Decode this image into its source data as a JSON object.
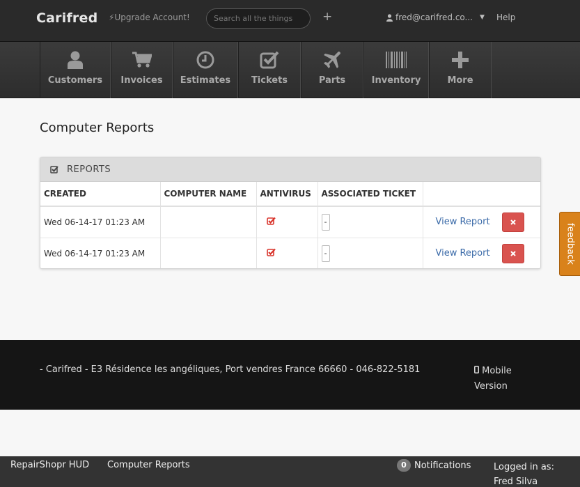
{
  "topbar": {
    "brand": "Carifred",
    "upgrade": "Upgrade Account!",
    "search_placeholder": "Search all the things",
    "user_email": "fred@carifred.co...",
    "help": "Help"
  },
  "nav": [
    {
      "label": "Customers",
      "icon": "user-icon"
    },
    {
      "label": "Invoices",
      "icon": "cart-icon"
    },
    {
      "label": "Estimates",
      "icon": "clock-icon"
    },
    {
      "label": "Tickets",
      "icon": "check-square-icon"
    },
    {
      "label": "Parts",
      "icon": "plane-icon"
    },
    {
      "label": "Inventory",
      "icon": "barcode-icon"
    },
    {
      "label": "More",
      "icon": "plus-icon"
    }
  ],
  "page": {
    "title": "Computer Reports"
  },
  "reports": {
    "panel_title": "REPORTS",
    "columns": [
      "CREATED",
      "COMPUTER NAME",
      "ANTIVIRUS",
      "ASSOCIATED TICKET",
      ""
    ],
    "rows": [
      {
        "created": "Wed 06-14-17 01:23 AM",
        "computer_name": "",
        "ticket": "-",
        "view_label": "View Report"
      },
      {
        "created": "Wed 06-14-17 01:23 AM",
        "computer_name": "",
        "ticket": "-",
        "view_label": "View Report"
      }
    ]
  },
  "feedback": "feedback",
  "footer": {
    "address": "- Carifred - E3 Résidence les angéliques, Port vendres France 66660 - 046-822-5181",
    "mobile_version": "Mobile Version"
  },
  "hud": {
    "title": "RepairShopr HUD",
    "page": "Computer Reports",
    "notification_count": "0",
    "notifications_label": "Notifications",
    "logged_in": "Logged in as: Fred Silva"
  },
  "colors": {
    "danger": "#d9534f",
    "feedback": "#d9821b",
    "link": "#3a6aa8",
    "check": "#d9342b"
  }
}
